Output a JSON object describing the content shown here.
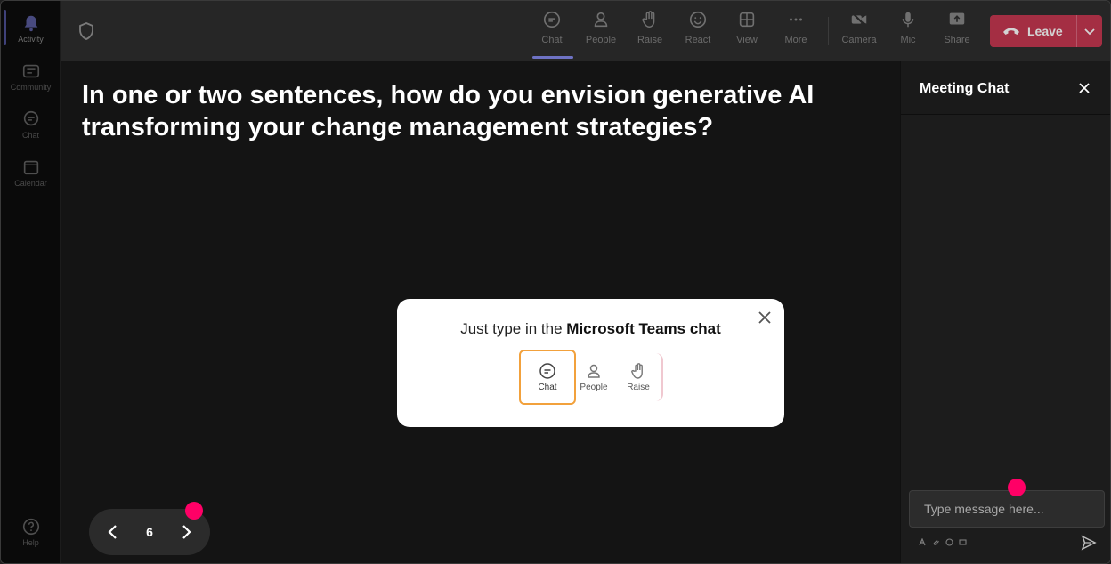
{
  "rail": {
    "items": [
      {
        "label": "Activity"
      },
      {
        "label": "Community"
      },
      {
        "label": "Chat"
      },
      {
        "label": "Calendar"
      }
    ],
    "help_label": "Help"
  },
  "toolbar": {
    "buttons": [
      {
        "label": "Chat",
        "icon": "chat-icon"
      },
      {
        "label": "People",
        "icon": "people-icon"
      },
      {
        "label": "Raise",
        "icon": "raise-hand-icon"
      },
      {
        "label": "React",
        "icon": "react-icon"
      },
      {
        "label": "View",
        "icon": "view-icon"
      },
      {
        "label": "More",
        "icon": "more-icon"
      },
      {
        "label": "Camera",
        "icon": "camera-off-icon"
      },
      {
        "label": "Mic",
        "icon": "mic-icon"
      },
      {
        "label": "Share",
        "icon": "share-icon"
      }
    ],
    "leave_label": "Leave",
    "leave_color": "#c4314b"
  },
  "stage": {
    "question": "In one or two sentences, how do you envision generative AI transforming your change management strategies?",
    "page_number": "6"
  },
  "popup": {
    "text_prefix": "Just type in the ",
    "text_bold": "Microsoft Teams chat",
    "buttons": [
      {
        "label": "Chat"
      },
      {
        "label": "People"
      },
      {
        "label": "Raise"
      }
    ],
    "highlight_color": "#f2a13c"
  },
  "chat": {
    "title": "Meeting Chat",
    "input_placeholder": "Type message here..."
  },
  "colors": {
    "accent": "#6b6fd6",
    "marker": "#ff0066"
  }
}
